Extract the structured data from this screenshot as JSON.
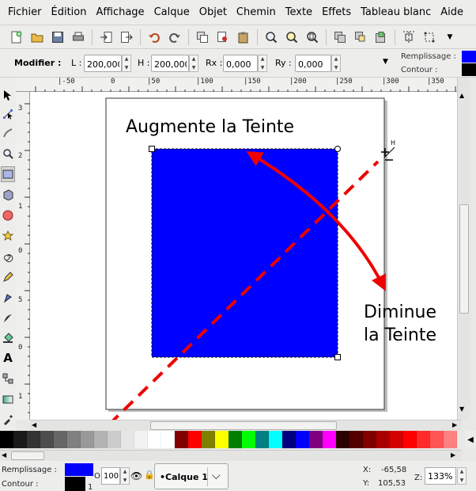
{
  "menu": [
    "Fichier",
    "Édition",
    "Affichage",
    "Calque",
    "Objet",
    "Chemin",
    "Texte",
    "Effets",
    "Tableau blanc",
    "Aide"
  ],
  "toolbar": {
    "icons": [
      "new-document-icon",
      "open-icon",
      "save-icon",
      "print-icon",
      "import-icon",
      "export-icon",
      "undo-icon",
      "redo-icon",
      "duplicate-icon",
      "cut-icon",
      "paste-icon",
      "zoom-selection-icon",
      "zoom-drawing-icon",
      "zoom-page-icon",
      "group-icon",
      "ungroup-icon",
      "raise-icon",
      "align-icon",
      "transform-icon"
    ]
  },
  "context": {
    "modifier_label": "Modifier :",
    "w_label": "L :",
    "w_value": "200,000",
    "h_label": "H :",
    "h_value": "200,000",
    "rx_label": "Rx :",
    "rx_value": "0,000",
    "ry_label": "Ry :",
    "ry_value": "0,000",
    "fill_label": "Remplissage :",
    "stroke_label": "Contour :"
  },
  "ruler": {
    "top": [
      "|-50",
      "0",
      "|50",
      "|100",
      "|150",
      "|200",
      "|250",
      "|300",
      "|350"
    ],
    "left": [
      "3",
      "2",
      "1",
      "0",
      "5",
      "0",
      "1"
    ]
  },
  "canvas": {
    "label_top": "Augmente la Teinte",
    "label_right_line1": "Diminue",
    "label_right_line2": "la Teinte",
    "rect_color": "#0000ff",
    "arrow_color": "#ee0000",
    "dash_color": "#ee0000",
    "cursor_h": "H"
  },
  "palette": [
    "#000000",
    "#1a1a1a",
    "#333333",
    "#4d4d4d",
    "#666666",
    "#808080",
    "#999999",
    "#b3b3b3",
    "#cccccc",
    "#e6e6e6",
    "#f2f2f2",
    "#ffffff",
    "#ffffff",
    "#800000",
    "#ff0000",
    "#808000",
    "#ffff00",
    "#008000",
    "#00ff00",
    "#008080",
    "#00ffff",
    "#000080",
    "#0000ff",
    "#800080",
    "#ff00ff",
    "#2b0000",
    "#550000",
    "#800000",
    "#aa0000",
    "#d40000",
    "#ff0000",
    "#ff2a2a",
    "#ff5555",
    "#ff8080"
  ],
  "status": {
    "fill_label": "Remplissage :",
    "stroke_label": "Contour :",
    "fill_color": "#0000ff",
    "stroke_color": "#000000",
    "opacity_label": "O",
    "opacity_value": "100",
    "stroke_width": "1",
    "layer_name": "•Calque 1",
    "x_label": "X:",
    "x_value": "-65,58",
    "y_label": "Y:",
    "y_value": "105,53",
    "zoom_label": "Z:",
    "zoom_value": "133%"
  }
}
